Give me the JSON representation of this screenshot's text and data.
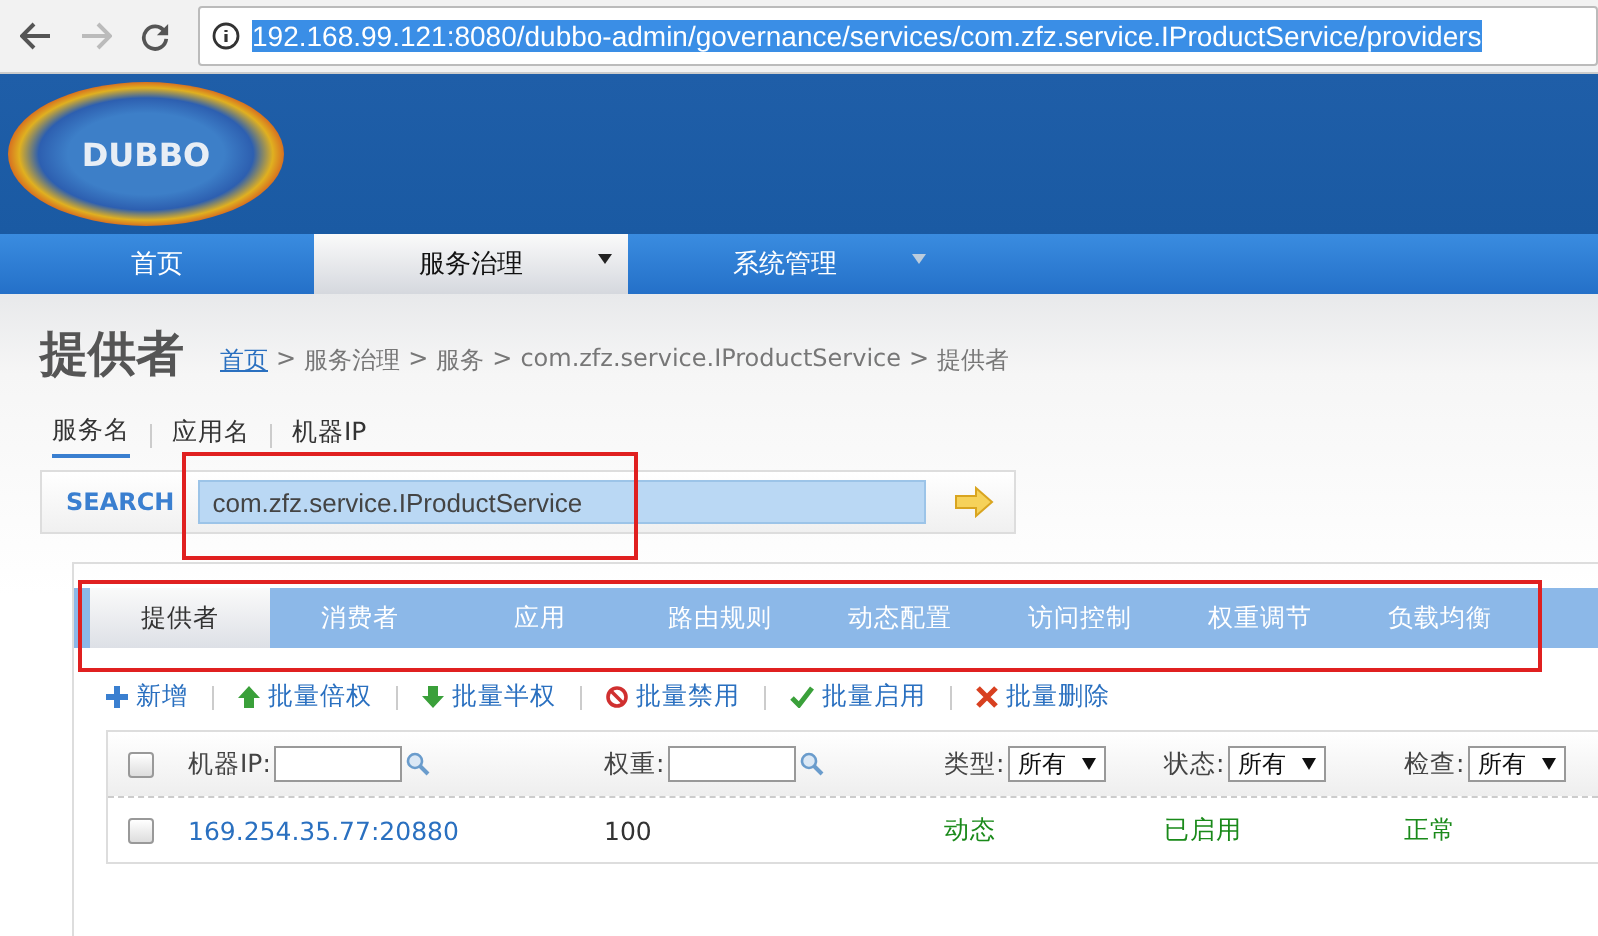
{
  "browser": {
    "url": "192.168.99.121:8080/dubbo-admin/governance/services/com.zfz.service.IProductService/providers"
  },
  "header": {
    "logo": "DUBBO"
  },
  "nav": [
    {
      "label": "首页",
      "selected": false,
      "caret": false
    },
    {
      "label": "服务治理",
      "selected": true,
      "caret": true
    },
    {
      "label": "系统管理",
      "selected": false,
      "caret": true
    }
  ],
  "page": {
    "title": "提供者",
    "separator": ">",
    "breadcrumb": [
      {
        "label": "首页",
        "kind": "link"
      },
      {
        "label": "服务治理",
        "kind": "text"
      },
      {
        "label": "服务",
        "kind": "text"
      },
      {
        "label": "com.zfz.service.IProductService",
        "kind": "text"
      },
      {
        "label": "提供者",
        "kind": "text"
      }
    ]
  },
  "search_tabs": [
    {
      "label": "服务名",
      "selected": true
    },
    {
      "label": "应用名",
      "selected": false
    },
    {
      "label": "机器IP",
      "selected": false
    }
  ],
  "search": {
    "label": "SEARCH",
    "value": "com.zfz.service.IProductService"
  },
  "tabs": [
    {
      "label": "提供者",
      "selected": true
    },
    {
      "label": "消费者",
      "selected": false
    },
    {
      "label": "应用",
      "selected": false
    },
    {
      "label": "路由规则",
      "selected": false
    },
    {
      "label": "动态配置",
      "selected": false
    },
    {
      "label": "访问控制",
      "selected": false
    },
    {
      "label": "权重调节",
      "selected": false
    },
    {
      "label": "负载均衡",
      "selected": false
    }
  ],
  "actions": [
    {
      "label": "新增",
      "kind": "plus"
    },
    {
      "label": "批量倍权",
      "kind": "up"
    },
    {
      "label": "批量半权",
      "kind": "down"
    },
    {
      "label": "批量禁用",
      "kind": "ban"
    },
    {
      "label": "批量启用",
      "kind": "check"
    },
    {
      "label": "批量删除",
      "kind": "cross"
    }
  ],
  "table": {
    "select_all_checked": false,
    "filters": [
      {
        "label": "机器IP:",
        "kind": "text"
      },
      {
        "label": "权重:",
        "kind": "text"
      },
      {
        "label": "类型:",
        "kind": "select",
        "value": "所有"
      },
      {
        "label": "状态:",
        "kind": "select",
        "value": "所有"
      },
      {
        "label": "检查:",
        "kind": "select",
        "value": "所有"
      }
    ],
    "rows": [
      {
        "checked": false,
        "address": "169.254.35.77:20880",
        "weight": "100",
        "type": "动态",
        "status": "已启用",
        "check": "正常"
      }
    ]
  }
}
